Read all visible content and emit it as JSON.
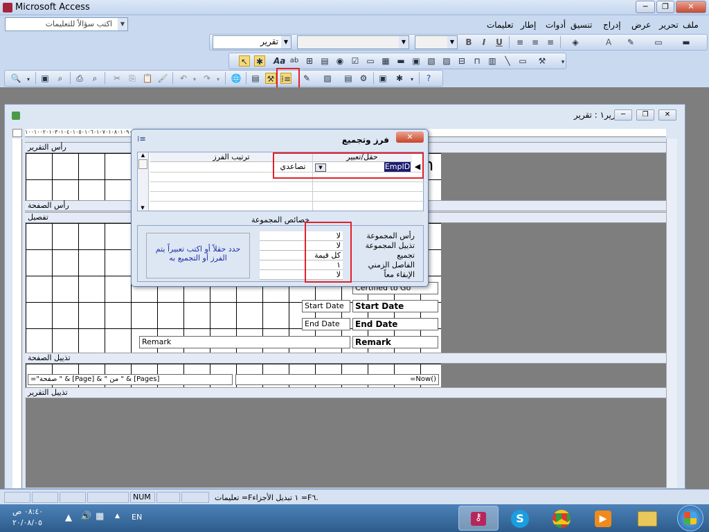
{
  "app": {
    "title": "Microsoft Access"
  },
  "window_buttons": {
    "minimize": "─",
    "restore": "❐",
    "close": "✕"
  },
  "help": {
    "placeholder": "اكتب سؤالاً للتعليمات",
    "arrow": "▼"
  },
  "menu": [
    "ملف",
    "تحرير",
    "عرض",
    "إدراج",
    "تنسيق",
    "أدوات",
    "إطار",
    "تعليمات"
  ],
  "format_toolbar": {
    "object_combo": "تقرير",
    "font_combo": "",
    "size_combo": "",
    "bold": "B",
    "italic": "I",
    "underline": "U"
  },
  "toolbox": {
    "text_tool": "Aa",
    "label_tool": "ab"
  },
  "child_window": {
    "title": "تقرير١ : تقرير"
  },
  "ruler_text": "١٠٠١٠٠٢٠١٠٣٠١٠٤٠١٠٥٠١٠٦٠١٠٧٠١٠٨٠١٠٩٠١٠١٠٠١١١٠١١٢٠١١٣٠١١٤٠١١٥٠١١٦٠١١٧٠١١٨٠١١٩٠١٢٠٠١٢١٠١٢٢٠١٢٣٠١٢٤٠",
  "sections": {
    "report_header": "رأس التقرير",
    "page_header": "رأس الصفحة",
    "detail": "تفصيل",
    "page_footer": "تذييل الصفحة",
    "report_footer": "تذييل التقرير"
  },
  "controls": {
    "start_date_label": "Start Date",
    "start_date_field": "Start Date",
    "end_date_label": "End Date",
    "end_date_field": "End Date",
    "remark_label": "Remark",
    "remark_field": "Remark",
    "page_expr": "=\"صفحة \" & [Page] & \" من \" & [Pages]",
    "now_expr": "=Now()",
    "partial_n": "n",
    "partial_text": "Certified to Go"
  },
  "dialog": {
    "title": "فرز وتجميع",
    "close": "✕",
    "col_field": "حقل/تعبير",
    "col_sort": "ترتيب الفرز",
    "row1_field": "EmpID",
    "row1_sort": "تصاعدي",
    "props_title": "خصائص المجموعة",
    "props": [
      {
        "label": "رأس المجموعة",
        "value": "لا"
      },
      {
        "label": "تذييل المجموعة",
        "value": "لا"
      },
      {
        "label": "تجميع",
        "value": "كل قيمة"
      },
      {
        "label": "الفاصل الزمني",
        "value": "١"
      },
      {
        "label": "الإبقاء معاً",
        "value": "لا"
      }
    ],
    "hint": "حدد حقلاً أو اكتب تعبيراً يتم الفرز أو التجميع به"
  },
  "status": {
    "num": "NUM",
    "text": "تعليمات =F١ تبديل الأجزاء =F٦."
  },
  "taskbar": {
    "lang": "EN",
    "time": "٠٨:٤٠ ص",
    "date": "٢٠/٠٨/٠٥"
  },
  "colors": {
    "accent_red": "#e0202a",
    "report_bg": "#7e7e7e",
    "hint_text": "#1a2fa8"
  }
}
